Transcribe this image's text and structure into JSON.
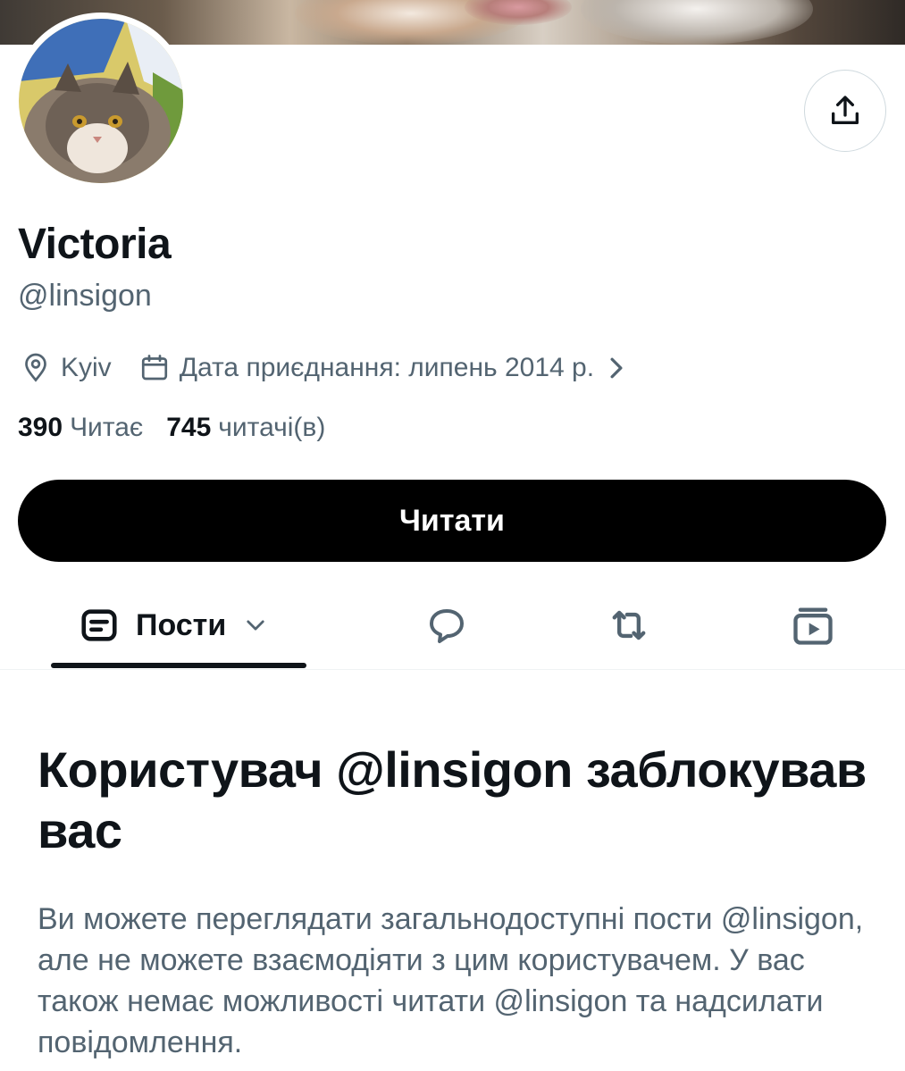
{
  "profile": {
    "name": "Victoria",
    "handle": "@linsigon",
    "location": "Kyiv",
    "joined": "Дата приєднання: липень 2014 р.",
    "following_count": "390",
    "following_label": "Читає",
    "followers_count": "745",
    "followers_label": "читачі(в)"
  },
  "actions": {
    "follow_label": "Читати"
  },
  "tabs": {
    "posts_label": "Пости"
  },
  "blocked": {
    "title": "Користувач @linsigon заблокував вас",
    "description": "Ви можете переглядати загальнодоступні пости @linsigon, але не можете взаємодіяти з цим користувачем. У вас також немає можливості читати @linsigon та надсилати повідомлення."
  },
  "icons": {
    "share": "share-icon",
    "location": "location-pin-icon",
    "calendar": "calendar-icon",
    "chevron": "chevron-right-icon",
    "posts": "posts-icon",
    "replies": "speech-bubble-icon",
    "reposts": "repost-icon",
    "media": "media-icon"
  },
  "colors": {
    "text_primary": "#0f1419",
    "text_secondary": "#536471",
    "button_bg": "#000000",
    "border": "#cfd9de"
  }
}
